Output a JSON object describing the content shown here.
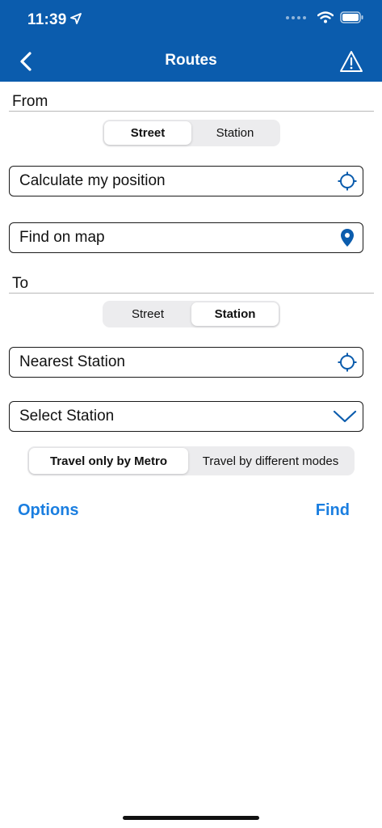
{
  "status_bar": {
    "time": "11:39"
  },
  "nav": {
    "title": "Routes"
  },
  "from": {
    "label": "From",
    "segments": [
      "Street",
      "Station"
    ],
    "active_segment": "Street",
    "fields": [
      {
        "text": "Calculate my position",
        "icon": "crosshair-icon"
      },
      {
        "text": "Find on map",
        "icon": "map-pin-icon"
      }
    ]
  },
  "to": {
    "label": "To",
    "segments": [
      "Street",
      "Station"
    ],
    "active_segment": "Station",
    "fields": [
      {
        "text": "Nearest Station",
        "icon": "crosshair-icon"
      },
      {
        "text": "Select Station",
        "icon": "chevron-down-icon"
      }
    ]
  },
  "travel_mode": {
    "options": [
      "Travel only by Metro",
      "Travel by different modes"
    ],
    "active": "Travel only by Metro"
  },
  "actions": {
    "options_label": "Options",
    "find_label": "Find"
  },
  "colors": {
    "header_bg": "#0b5cad",
    "accent": "#1a7ee0",
    "icon_blue": "#0b5cad"
  }
}
